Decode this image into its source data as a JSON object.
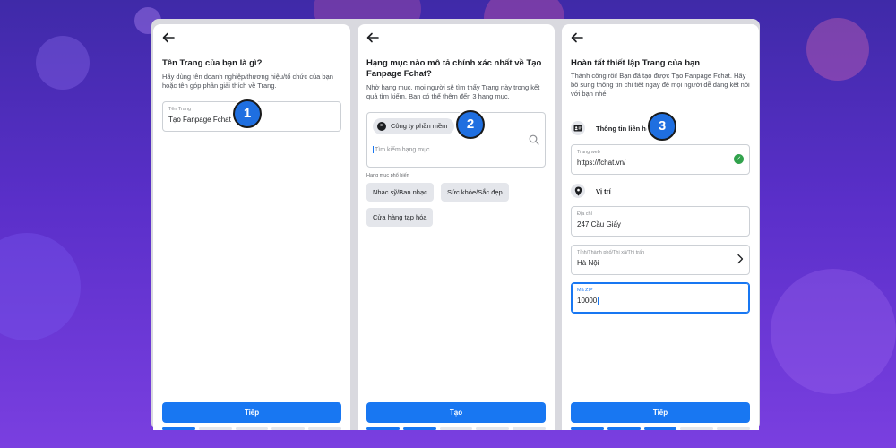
{
  "screen1": {
    "title": "Tên Trang của bạn là gì?",
    "description": "Hãy dùng tên doanh nghiệp/thương hiệu/tổ chức của bạn hoặc tên góp phần giải thích về Trang.",
    "name_field": {
      "label": "Tên Trang",
      "value": "Tạo Fanpage Fchat"
    },
    "step_badge": "1",
    "button_label": "Tiếp"
  },
  "screen2": {
    "title": "Hạng mục nào mô tả chính xác nhất về Tạo Fanpage Fchat?",
    "description": "Nhờ hạng mục, mọi người sẽ tìm thấy Trang này trong kết quả tìm kiếm. Bạn có thể thêm đến 3 hạng mục.",
    "selected_category": "Công ty phần mềm",
    "search_placeholder": "Tìm kiếm hạng mục",
    "popular_label": "Hạng mục phổ biến",
    "popular_categories": [
      "Nhạc sỹ/Ban nhạc",
      "Sức khỏe/Sắc đẹp",
      "Cửa hàng tạp hóa"
    ],
    "step_badge": "2",
    "button_label": "Tạo"
  },
  "screen3": {
    "title": "Hoàn tất thiết lập Trang của bạn",
    "description": "Thành công rồi! Bạn đã tạo được Tạo Fanpage Fchat. Hãy bổ sung thông tin chi tiết ngay để mọi người dễ dàng kết nối với bạn nhé.",
    "contact_section": "Thông tin liên hệ",
    "website_field": {
      "label": "Trang web",
      "value": "https://fchat.vn/"
    },
    "location_section": "Vị trí",
    "address_field": {
      "label": "Địa chỉ",
      "value": "247 Cầu Giấy"
    },
    "city_field": {
      "label": "Tỉnh/Thành phố/Thị xã/Thị trấn",
      "value": "Hà Nội"
    },
    "zip_field": {
      "label": "Mã ZIP",
      "value": "10000"
    },
    "step_badge": "3",
    "button_label": "Tiếp"
  },
  "colors": {
    "primary": "#1877f2",
    "badge": "#1f6fe0",
    "success": "#31a24c",
    "background": "#5a2fc9"
  },
  "progress": {
    "segments": 5,
    "screen1_done": 1,
    "screen2_done": 2,
    "screen3_done": 3
  }
}
